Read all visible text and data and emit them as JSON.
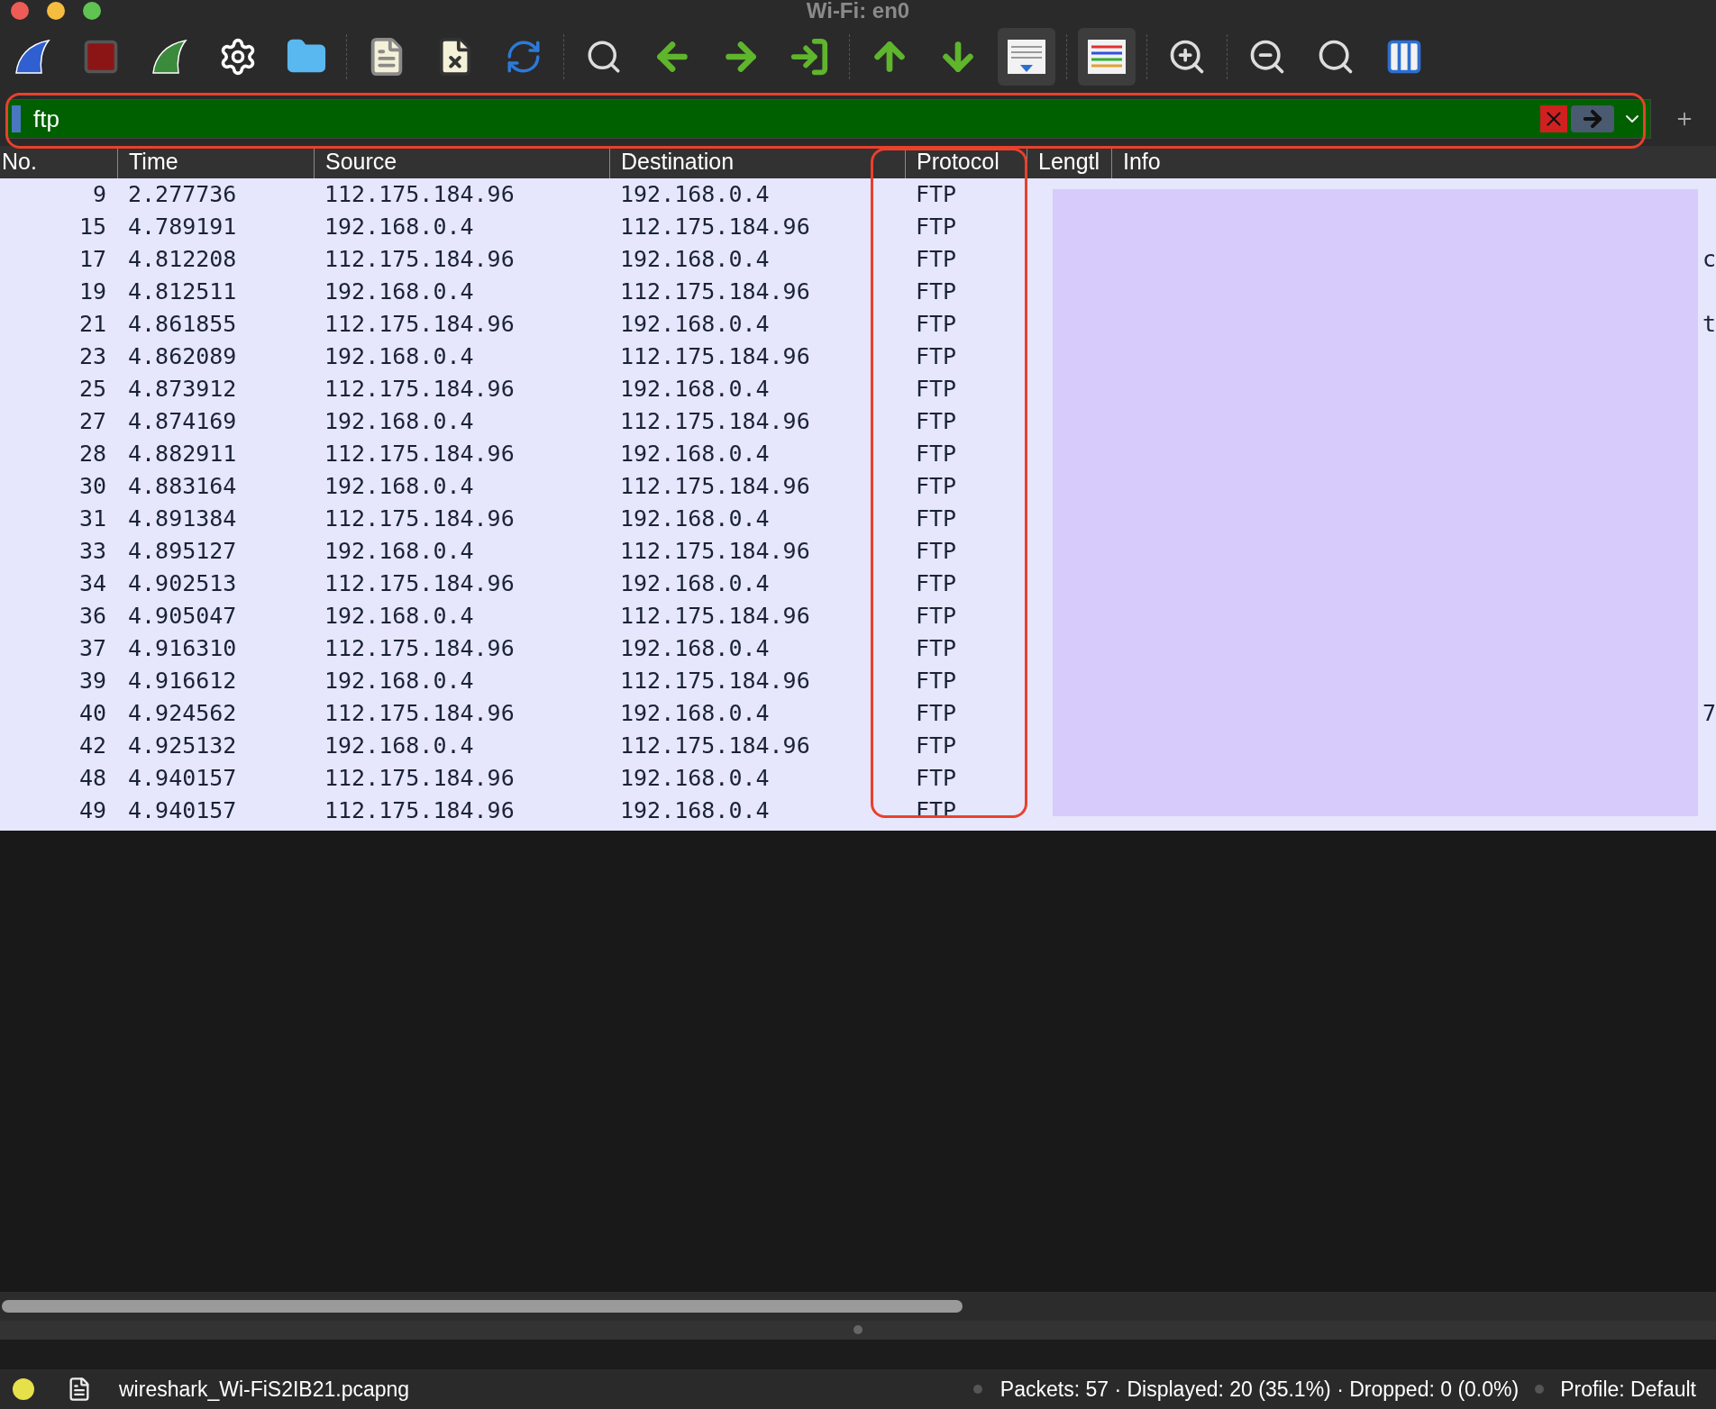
{
  "window": {
    "title": "Wi-Fi: en0"
  },
  "toolbar": [
    {
      "kind": "start",
      "selected": false
    },
    {
      "kind": "stop",
      "selected": false
    },
    {
      "kind": "restart",
      "selected": false
    },
    {
      "kind": "options",
      "selected": false
    },
    {
      "kind": "open",
      "selected": false
    },
    {
      "kind": "save",
      "selected": false
    },
    {
      "kind": "close",
      "selected": false
    },
    {
      "kind": "reload",
      "selected": false
    },
    {
      "kind": "find",
      "selected": false
    },
    {
      "kind": "back",
      "selected": false
    },
    {
      "kind": "forward",
      "selected": false
    },
    {
      "kind": "goto",
      "selected": false
    },
    {
      "kind": "first",
      "selected": false
    },
    {
      "kind": "last",
      "selected": false
    },
    {
      "kind": "autoscroll",
      "selected": true
    },
    {
      "kind": "colorize",
      "selected": true
    },
    {
      "kind": "zoomin",
      "selected": false
    },
    {
      "kind": "zoomout",
      "selected": false
    },
    {
      "kind": "zoomreset",
      "selected": false
    },
    {
      "kind": "resize",
      "selected": false
    }
  ],
  "filter": {
    "value": "ftp",
    "valid": true
  },
  "table": {
    "columns": [
      "No.",
      "Time",
      "Source",
      "Destination",
      "Protocol",
      "Lengtl",
      "Info"
    ],
    "rows": [
      {
        "no": "9",
        "time": "2.277736",
        "source": "112.175.184.96",
        "destination": "192.168.0.4",
        "protocol": "FTP"
      },
      {
        "no": "15",
        "time": "4.789191",
        "source": "192.168.0.4",
        "destination": "112.175.184.96",
        "protocol": "FTP"
      },
      {
        "no": "17",
        "time": "4.812208",
        "source": "112.175.184.96",
        "destination": "192.168.0.4",
        "protocol": "FTP",
        "info_tail": "c"
      },
      {
        "no": "19",
        "time": "4.812511",
        "source": "192.168.0.4",
        "destination": "112.175.184.96",
        "protocol": "FTP"
      },
      {
        "no": "21",
        "time": "4.861855",
        "source": "112.175.184.96",
        "destination": "192.168.0.4",
        "protocol": "FTP",
        "info_tail": "t"
      },
      {
        "no": "23",
        "time": "4.862089",
        "source": "192.168.0.4",
        "destination": "112.175.184.96",
        "protocol": "FTP"
      },
      {
        "no": "25",
        "time": "4.873912",
        "source": "112.175.184.96",
        "destination": "192.168.0.4",
        "protocol": "FTP"
      },
      {
        "no": "27",
        "time": "4.874169",
        "source": "192.168.0.4",
        "destination": "112.175.184.96",
        "protocol": "FTP"
      },
      {
        "no": "28",
        "time": "4.882911",
        "source": "112.175.184.96",
        "destination": "192.168.0.4",
        "protocol": "FTP"
      },
      {
        "no": "30",
        "time": "4.883164",
        "source": "192.168.0.4",
        "destination": "112.175.184.96",
        "protocol": "FTP"
      },
      {
        "no": "31",
        "time": "4.891384",
        "source": "112.175.184.96",
        "destination": "192.168.0.4",
        "protocol": "FTP"
      },
      {
        "no": "33",
        "time": "4.895127",
        "source": "192.168.0.4",
        "destination": "112.175.184.96",
        "protocol": "FTP"
      },
      {
        "no": "34",
        "time": "4.902513",
        "source": "112.175.184.96",
        "destination": "192.168.0.4",
        "protocol": "FTP"
      },
      {
        "no": "36",
        "time": "4.905047",
        "source": "192.168.0.4",
        "destination": "112.175.184.96",
        "protocol": "FTP"
      },
      {
        "no": "37",
        "time": "4.916310",
        "source": "112.175.184.96",
        "destination": "192.168.0.4",
        "protocol": "FTP"
      },
      {
        "no": "39",
        "time": "4.916612",
        "source": "192.168.0.4",
        "destination": "112.175.184.96",
        "protocol": "FTP"
      },
      {
        "no": "40",
        "time": "4.924562",
        "source": "112.175.184.96",
        "destination": "192.168.0.4",
        "protocol": "FTP",
        "info_tail": "7"
      },
      {
        "no": "42",
        "time": "4.925132",
        "source": "192.168.0.4",
        "destination": "112.175.184.96",
        "protocol": "FTP"
      },
      {
        "no": "48",
        "time": "4.940157",
        "source": "112.175.184.96",
        "destination": "192.168.0.4",
        "protocol": "FTP"
      },
      {
        "no": "49",
        "time": "4.940157",
        "source": "112.175.184.96",
        "destination": "192.168.0.4",
        "protocol": "FTP"
      }
    ]
  },
  "status_bar": {
    "file": "wireshark_Wi-FiS2IB21.pcapng",
    "stats": "Packets: 57 · Displayed: 20 (35.1%) · Dropped: 0 (0.0%)",
    "profile": "Profile: Default"
  }
}
